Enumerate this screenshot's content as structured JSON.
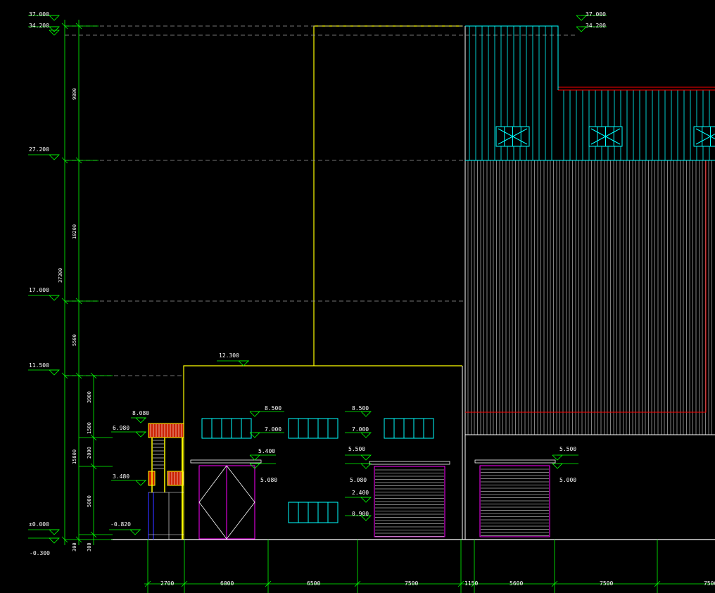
{
  "colors": {
    "background": "#000000",
    "dimension": "#00ff00",
    "outline": "#ffff00",
    "wall": "#ffffff",
    "cladding": "#00ffff",
    "accent": "#ff0000",
    "door": "#ff00ff",
    "dashed": "#9a9a9a",
    "stair_fill": "#cc2200",
    "blue_line": "#3030ff"
  },
  "elevations_left": [
    "37.000",
    "34.200",
    "27.200",
    "17.000",
    "11.500",
    "8.080",
    "6.980",
    "3.480",
    "±0.000",
    "-0.820",
    "-0.300"
  ],
  "elevations_right": [
    "37.000",
    "34.200"
  ],
  "roof_mark": "12.300",
  "vertical_dims": [
    "9800",
    "10200",
    "37300",
    "5500",
    "3900",
    "1500",
    "2000",
    "15800",
    "5000",
    "300",
    "300"
  ],
  "window_marks": {
    "w1_top": "8.500",
    "w1_bottom": "7.000",
    "w2_top": "8.500",
    "w2_bottom": "7.000",
    "w3_top": "2.400",
    "w3_bottom": "0.900"
  },
  "door_marks": {
    "d1_top": "5.400",
    "d1_bottom": "5.080",
    "d2_top": "5.500",
    "d2_bottom": "5.080",
    "d3_top": "5.500",
    "d3_bottom": "5.000"
  },
  "bottom_dims": [
    "2700",
    "6000",
    "6500",
    "7500",
    "1150",
    "5600",
    "7500",
    "7500"
  ]
}
